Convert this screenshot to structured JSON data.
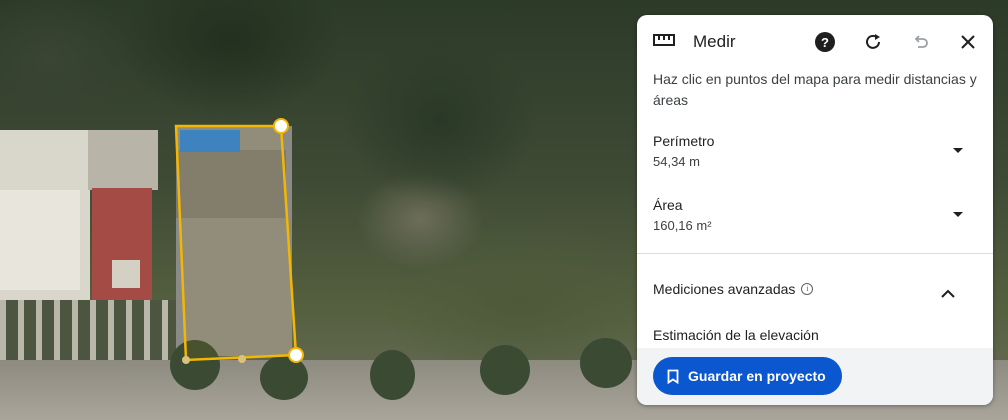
{
  "panel": {
    "title": "Medir",
    "description": "Haz clic en puntos del mapa para medir distancias y áreas",
    "perimeter": {
      "label": "Perímetro",
      "value": "54,34 m"
    },
    "area": {
      "label": "Área",
      "value": "160,16 m²"
    },
    "advanced": {
      "label": "Mediciones avanzadas"
    },
    "elevation": {
      "label": "Estimación de la elevación"
    },
    "save_button": "Guardar en proyecto"
  },
  "icons": [
    "ruler-icon",
    "help-icon",
    "refresh-icon",
    "undo-icon",
    "close-icon",
    "bookmark-icon",
    "info-icon",
    "chevron-down-icon",
    "chevron-up-icon"
  ],
  "colors": {
    "accent": "#0b57d0",
    "measure_line": "#f2b705",
    "panel_bg": "#ffffff"
  }
}
